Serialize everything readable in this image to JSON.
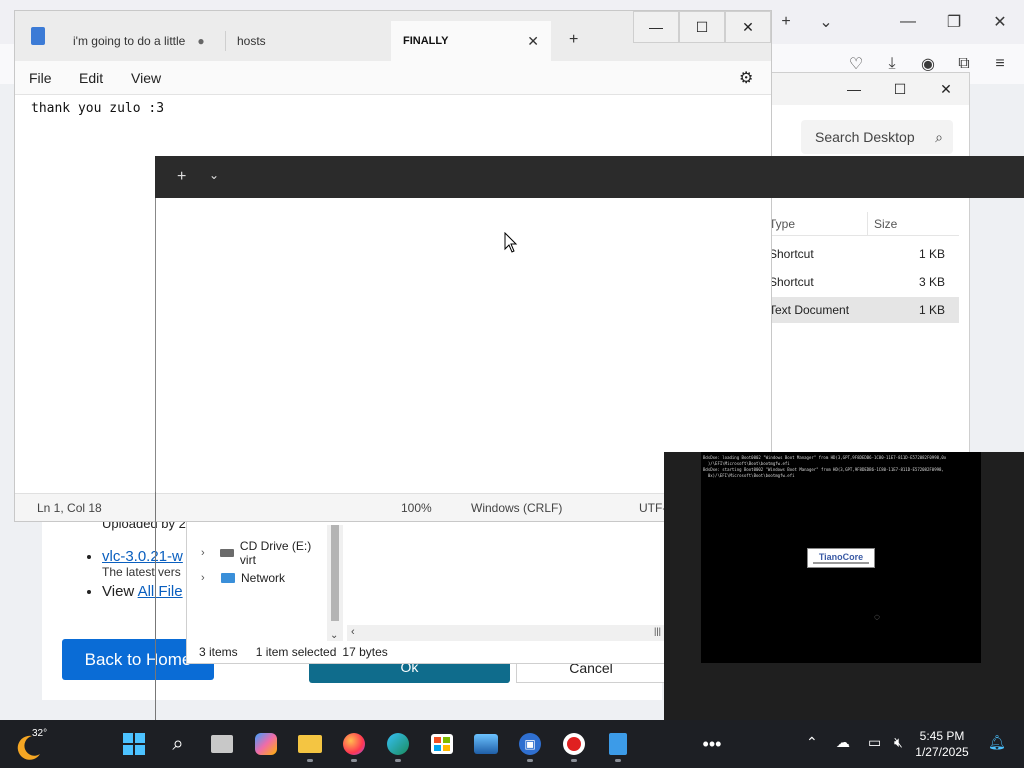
{
  "browser": {
    "page": {
      "uploaded_text": "Uploaded by 2",
      "link_vlc": "vlc-3.0.21-w",
      "latest_text": "The latest vers",
      "view_prefix": "View ",
      "view_link": "All File",
      "back_home": "Back to Home",
      "ok_label": "Ok",
      "cancel_label": "Cancel"
    }
  },
  "explorer": {
    "search_placeholder": "Search Desktop",
    "columns": {
      "type": "Type",
      "size": "Size"
    },
    "files": [
      {
        "type": "Shortcut",
        "size": "1 KB"
      },
      {
        "type": "Shortcut",
        "size": "3 KB"
      },
      {
        "type": "Text Document",
        "size": "1 KB"
      }
    ],
    "nav": {
      "cd_drive": "CD Drive (E:) virt",
      "network": "Network"
    },
    "status": {
      "items": "3 items",
      "selected": "1 item selected",
      "bytes": "17 bytes"
    }
  },
  "notepad": {
    "tabs": [
      {
        "title": "i'm going to do a little"
      },
      {
        "title": "hosts"
      },
      {
        "title": "FINALLY"
      }
    ],
    "menu": {
      "file": "File",
      "edit": "Edit",
      "view": "View"
    },
    "content": "thank you zulo :3",
    "status": {
      "position": "Ln 1, Col 18",
      "zoom": "100%",
      "line_ending": "Windows (CRLF)",
      "encoding": "UTF-"
    }
  },
  "vm": {
    "log_lines": [
      "BdsDxe: loading Boot0002 \"Windows Boot Manager\" from HD(3,GPT,9F8DEDB6-1C80-11E7-811D-E572082F0998,0x",
      "  )/\\EFI\\Microsoft\\Boot\\bootmgfw.efi",
      "BdsDxe: starting Boot0002 \"Windows Boot Manager\" from HD(3,GPT,9F8DEDB6-1C80-11E7-811D-E572082F0998,",
      "  0x)/\\EFI\\Microsoft\\Boot\\bootmgfw.efi"
    ],
    "logo_text": "TianoCore"
  },
  "taskbar": {
    "weather_temp": "32°",
    "time": "5:45 PM",
    "date": "1/27/2025"
  }
}
